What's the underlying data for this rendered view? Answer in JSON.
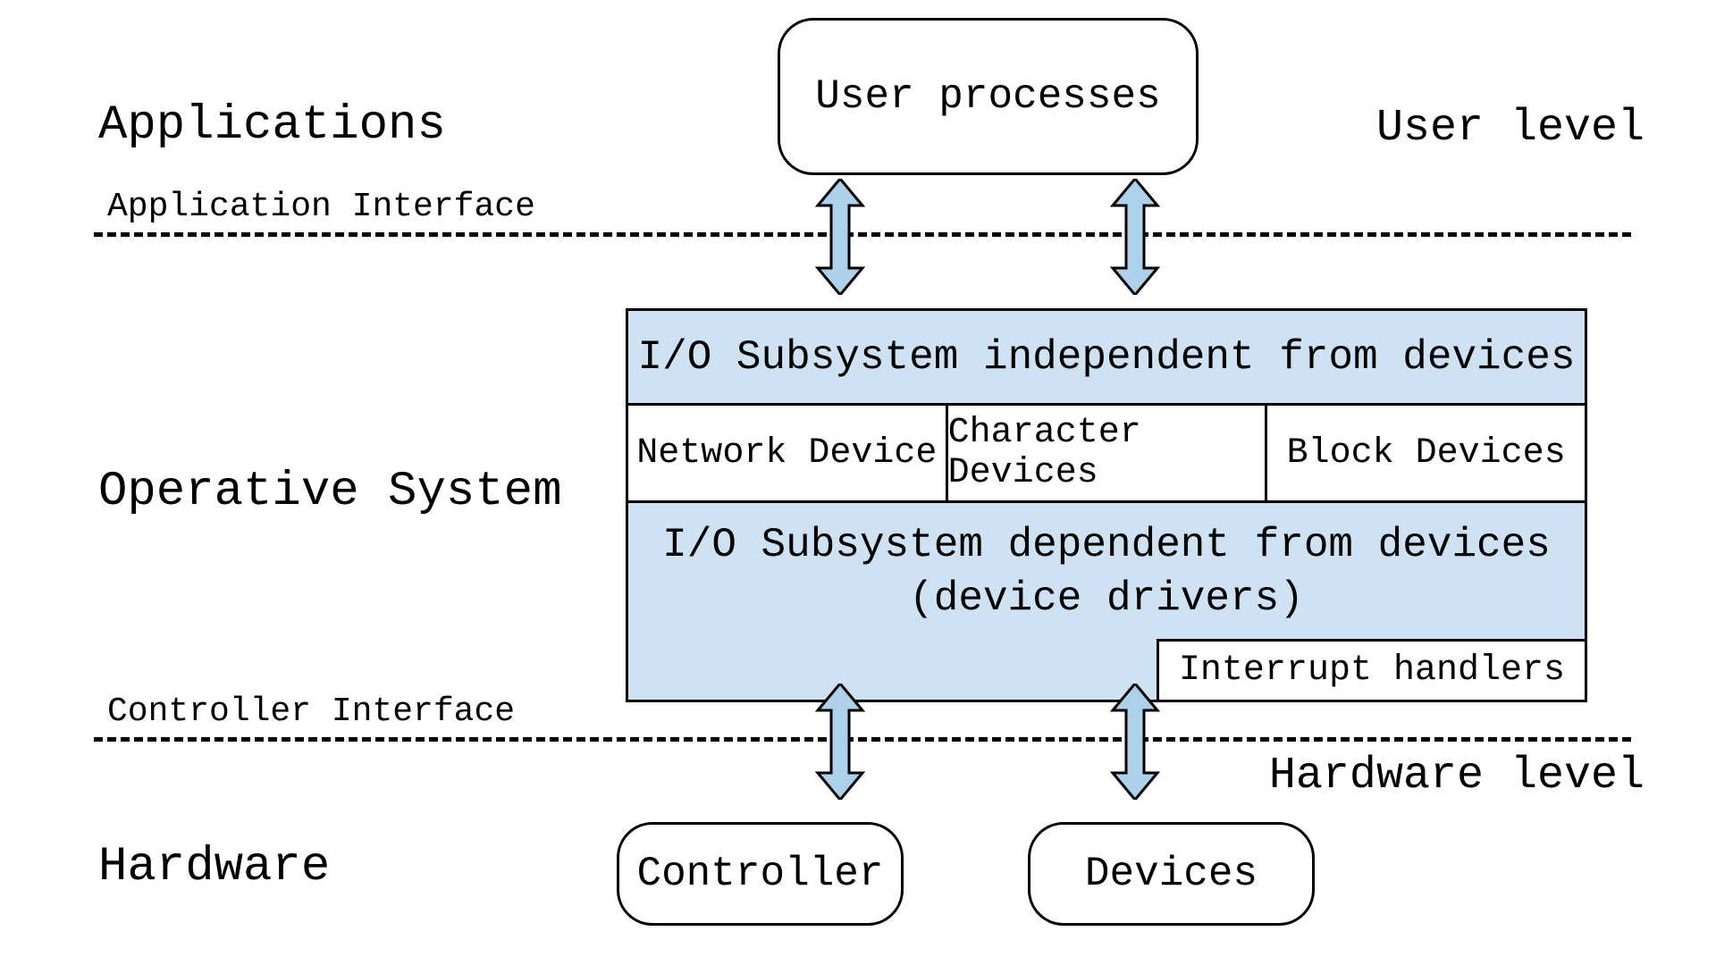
{
  "labels": {
    "applications": "Applications",
    "operative_system": "Operative System",
    "hardware": "Hardware",
    "user_level": "User level",
    "hardware_level": "Hardware level"
  },
  "interfaces": {
    "application": "Application Interface",
    "controller": "Controller Interface"
  },
  "nodes": {
    "user_processes": "User processes",
    "controller": "Controller",
    "devices": "Devices"
  },
  "os": {
    "io_independent": "I/O Subsystem independent from devices",
    "device_types": {
      "network": "Network Device",
      "character": "Character Devices",
      "block": "Block Devices"
    },
    "io_dependent_line1": "I/O Subsystem dependent from devices",
    "io_dependent_line2": "(device drivers)",
    "interrupt_handlers": "Interrupt handlers"
  },
  "colors": {
    "band_fill": "#cfe2f3",
    "arrow_fill": "#add1eb",
    "stroke": "#000000"
  }
}
